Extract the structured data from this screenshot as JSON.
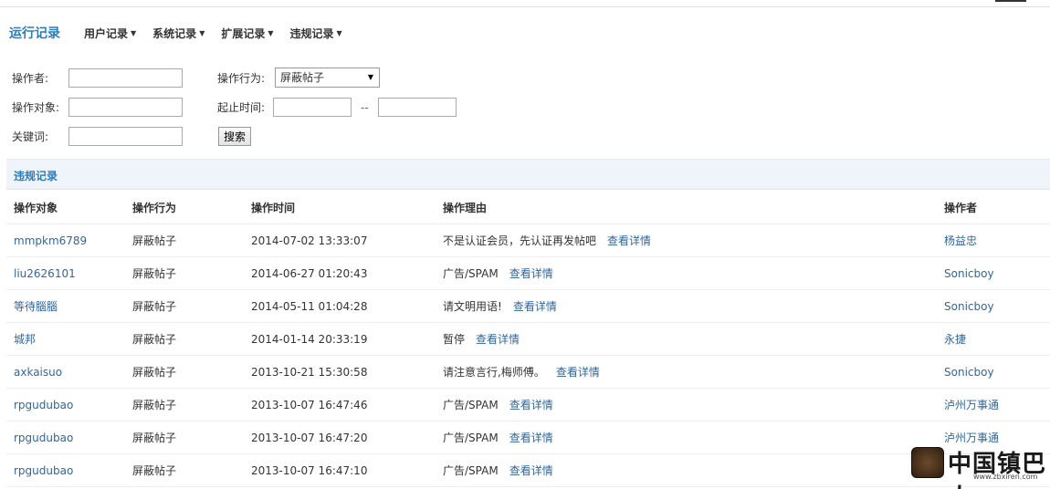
{
  "header": {
    "title": "运行记录",
    "nav": [
      {
        "label": "用户记录"
      },
      {
        "label": "系统记录"
      },
      {
        "label": "扩展记录"
      },
      {
        "label": "违规记录"
      }
    ]
  },
  "filters": {
    "operator_label": "操作者:",
    "action_label": "操作行为:",
    "action_value": "屏蔽帖子",
    "target_label": "操作对象:",
    "time_label": "起止时间:",
    "time_separator": "--",
    "keyword_label": "关键词:",
    "search_label": "搜索"
  },
  "section": {
    "title": "违规记录"
  },
  "table": {
    "columns": [
      "操作对象",
      "操作行为",
      "操作时间",
      "操作理由",
      "操作者"
    ],
    "detail_link": "查看详情",
    "rows": [
      {
        "target": "mmpkm6789",
        "action": "屏蔽帖子",
        "time": "2014-07-02 13:33:07",
        "reason": "不是认证会员，先认证再发帖吧",
        "operator": "杨益忠"
      },
      {
        "target": "liu2626101",
        "action": "屏蔽帖子",
        "time": "2014-06-27 01:20:43",
        "reason": "广告/SPAM",
        "operator": "Sonicboy"
      },
      {
        "target": "等待腦腦",
        "action": "屏蔽帖子",
        "time": "2014-05-11 01:04:28",
        "reason": "请文明用语!",
        "operator": "Sonicboy"
      },
      {
        "target": "城邦",
        "action": "屏蔽帖子",
        "time": "2014-01-14 20:33:19",
        "reason": "暂停",
        "operator": "永捷"
      },
      {
        "target": "axkaisuo",
        "action": "屏蔽帖子",
        "time": "2013-10-21 15:30:58",
        "reason": "请注意言行,梅师傅。",
        "operator": "Sonicboy"
      },
      {
        "target": "rpgudubao",
        "action": "屏蔽帖子",
        "time": "2013-10-07 16:47:46",
        "reason": "广告/SPAM",
        "operator": "泸州万事通"
      },
      {
        "target": "rpgudubao",
        "action": "屏蔽帖子",
        "time": "2013-10-07 16:47:20",
        "reason": "广告/SPAM",
        "operator": "泸州万事通"
      },
      {
        "target": "rpgudubao",
        "action": "屏蔽帖子",
        "time": "2013-10-07 16:47:10",
        "reason": "广告/SPAM",
        "operator": ""
      }
    ]
  },
  "watermark": {
    "text": "中国镇巴人",
    "url": "www.zbxiren.com"
  }
}
